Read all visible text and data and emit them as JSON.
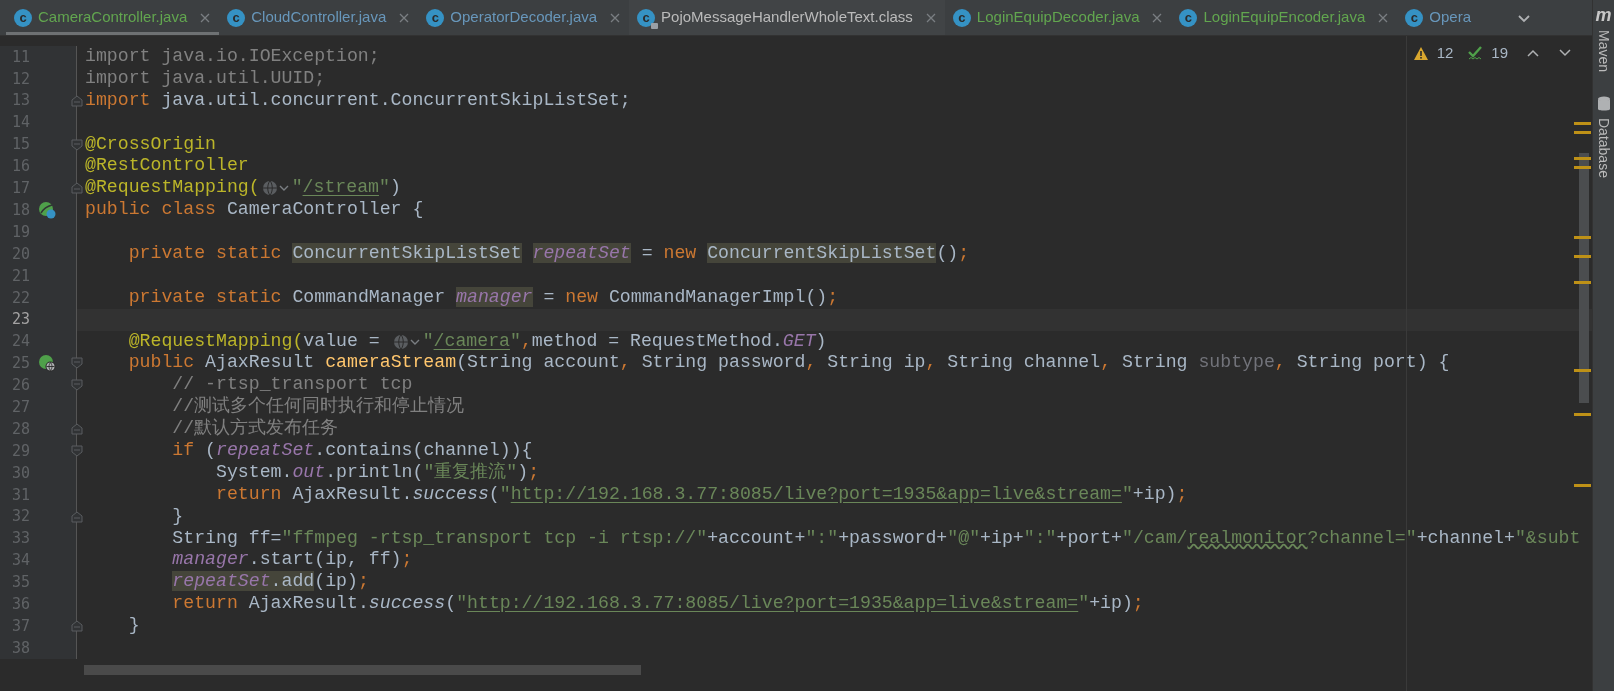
{
  "tabs": [
    {
      "label": "CameraController.java",
      "kind": "java",
      "icon_text": "c",
      "color": "#62a64f",
      "selected": true,
      "closable": true
    },
    {
      "label": "CloudController.java",
      "kind": "java",
      "icon_text": "c",
      "color": "#6897bb",
      "selected": false,
      "closable": true
    },
    {
      "label": "OperatorDecoder.java",
      "kind": "java",
      "icon_text": "c",
      "color": "#6897bb",
      "selected": false,
      "closable": true
    },
    {
      "label": "PojoMessageHandlerWholeText.class",
      "kind": "class",
      "icon_text": "c",
      "color": "#bbbbbb",
      "selected": false,
      "closable": true
    },
    {
      "label": "LoginEquipDecoder.java",
      "kind": "java",
      "icon_text": "c",
      "color": "#62a64f",
      "selected": false,
      "closable": true
    },
    {
      "label": "LoginEquipEncoder.java",
      "kind": "java",
      "icon_text": "c",
      "color": "#62a64f",
      "selected": false,
      "closable": true
    },
    {
      "label": "Opera",
      "kind": "java",
      "icon_text": "c",
      "color": "#6897bb",
      "selected": false,
      "closable": false
    }
  ],
  "inspections": {
    "warnings": "12",
    "weak_warnings": "19"
  },
  "side_tools": [
    {
      "kind": "maven",
      "icon_text": "m",
      "label": "Maven"
    },
    {
      "kind": "database",
      "label": "Database"
    }
  ],
  "lines": [
    {
      "number": "11",
      "current": false,
      "tokens": [
        {
          "kind": "unused",
          "text": "import java.io.IOException;"
        }
      ]
    },
    {
      "number": "12",
      "current": false,
      "tokens": [
        {
          "kind": "unused",
          "text": "import java.util.UUID;"
        }
      ]
    },
    {
      "number": "13",
      "current": false,
      "fold": {
        "kind": "end"
      },
      "tokens": [
        {
          "kind": "kw",
          "text": "import "
        },
        {
          "kind": "plain",
          "text": "java.util.concurrent.ConcurrentSkipListSet;"
        }
      ]
    },
    {
      "number": "14",
      "current": false
    },
    {
      "number": "15",
      "current": false,
      "fold": {
        "kind": "start"
      },
      "tokens": [
        {
          "kind": "ann",
          "text": "@CrossOrigin"
        }
      ]
    },
    {
      "number": "16",
      "current": false,
      "tokens": [
        {
          "kind": "ann",
          "text": "@RestController"
        }
      ]
    },
    {
      "number": "17",
      "current": false,
      "fold": {
        "kind": "end"
      },
      "tokens": [
        {
          "kind": "ann",
          "text": "@RequestMapping("
        },
        {
          "kind": "globe"
        },
        {
          "kind": "str",
          "text": "\""
        },
        {
          "kind": "link",
          "text": "/stream"
        },
        {
          "kind": "str",
          "text": "\""
        },
        {
          "kind": "plain",
          "text": ")"
        }
      ]
    },
    {
      "number": "18",
      "current": false,
      "gutter_icon": {
        "kind": "bean"
      },
      "tokens": [
        {
          "kind": "kw",
          "text": "public class "
        },
        {
          "kind": "plain",
          "text": "CameraController {"
        }
      ]
    },
    {
      "number": "19",
      "current": false
    },
    {
      "number": "20",
      "current": false,
      "tokens": [
        {
          "kind": "kw",
          "text": "    private static "
        },
        {
          "kind": "type_hl",
          "text": "ConcurrentSkipListSet "
        },
        {
          "kind": "field_hl",
          "text": "repeatSet"
        },
        {
          "kind": "plain",
          "text": " = "
        },
        {
          "kind": "kw",
          "text": "new "
        },
        {
          "kind": "type_hl",
          "text": "ConcurrentSkipListSet"
        },
        {
          "kind": "plain",
          "text": "()"
        },
        {
          "kind": "kw",
          "text": ";"
        }
      ]
    },
    {
      "number": "21",
      "current": false
    },
    {
      "number": "22",
      "current": false,
      "tokens": [
        {
          "kind": "kw",
          "text": "    private static "
        },
        {
          "kind": "plain",
          "text": "CommandManager "
        },
        {
          "kind": "field_hl",
          "text": "manager"
        },
        {
          "kind": "plain",
          "text": " = "
        },
        {
          "kind": "kw",
          "text": "new "
        },
        {
          "kind": "plain",
          "text": "CommandManagerImpl()"
        },
        {
          "kind": "kw",
          "text": ";"
        }
      ]
    },
    {
      "number": "23",
      "current": true
    },
    {
      "number": "24",
      "current": false,
      "tokens": [
        {
          "kind": "ann",
          "text": "    @RequestMapping("
        },
        {
          "kind": "plain",
          "text": "value = "
        },
        {
          "kind": "globe"
        },
        {
          "kind": "str",
          "text": "\""
        },
        {
          "kind": "link",
          "text": "/camera"
        },
        {
          "kind": "str",
          "text": "\""
        },
        {
          "kind": "kw",
          "text": ","
        },
        {
          "kind": "plain",
          "text": "method = RequestMethod."
        },
        {
          "kind": "field",
          "text": "GET"
        },
        {
          "kind": "plain",
          "text": ")"
        }
      ]
    },
    {
      "number": "25",
      "current": false,
      "gutter_icon": {
        "kind": "web"
      },
      "fold": {
        "kind": "start"
      },
      "tokens": [
        {
          "kind": "kw",
          "text": "    public "
        },
        {
          "kind": "plain",
          "text": "AjaxResult "
        },
        {
          "kind": "method",
          "text": "cameraStream"
        },
        {
          "kind": "plain",
          "text": "(String account"
        },
        {
          "kind": "kw",
          "text": ", "
        },
        {
          "kind": "plain",
          "text": "String password"
        },
        {
          "kind": "kw",
          "text": ", "
        },
        {
          "kind": "plain",
          "text": "String ip"
        },
        {
          "kind": "kw",
          "text": ", "
        },
        {
          "kind": "plain",
          "text": "String channel"
        },
        {
          "kind": "kw",
          "text": ", "
        },
        {
          "kind": "plain",
          "text": "String "
        },
        {
          "kind": "param_unused",
          "text": "subtype"
        },
        {
          "kind": "kw",
          "text": ", "
        },
        {
          "kind": "plain",
          "text": "String port) {"
        }
      ]
    },
    {
      "number": "26",
      "current": false,
      "fold": {
        "kind": "start"
      },
      "tokens": [
        {
          "kind": "comment",
          "text": "        // -rtsp_transport tcp"
        }
      ]
    },
    {
      "number": "27",
      "current": false,
      "tokens": [
        {
          "kind": "comment",
          "text": "        //测试多个任何同时执行和停止情况"
        }
      ]
    },
    {
      "number": "28",
      "current": false,
      "fold": {
        "kind": "end"
      },
      "tokens": [
        {
          "kind": "comment",
          "text": "        //默认方式发布任务"
        }
      ]
    },
    {
      "number": "29",
      "current": false,
      "fold": {
        "kind": "start"
      },
      "tokens": [
        {
          "kind": "kw",
          "text": "        if "
        },
        {
          "kind": "plain",
          "text": "("
        },
        {
          "kind": "field",
          "text": "repeatSet"
        },
        {
          "kind": "plain",
          "text": ".contains(channel)){"
        }
      ]
    },
    {
      "number": "30",
      "current": false,
      "tokens": [
        {
          "kind": "plain",
          "text": "            System."
        },
        {
          "kind": "field",
          "text": "out"
        },
        {
          "kind": "plain",
          "text": ".println("
        },
        {
          "kind": "str",
          "text": "\"重复推流\""
        },
        {
          "kind": "plain",
          "text": ")"
        },
        {
          "kind": "kw",
          "text": ";"
        }
      ]
    },
    {
      "number": "31",
      "current": false,
      "tokens": [
        {
          "kind": "kw",
          "text": "            return "
        },
        {
          "kind": "plain",
          "text": "AjaxResult."
        },
        {
          "kind": "static",
          "text": "success"
        },
        {
          "kind": "plain",
          "text": "("
        },
        {
          "kind": "str",
          "text": "\""
        },
        {
          "kind": "link",
          "text": "http://192.168.3.77:8085/live?port=1935&app=live&stream="
        },
        {
          "kind": "str",
          "text": "\""
        },
        {
          "kind": "plain",
          "text": "+ip)"
        },
        {
          "kind": "kw",
          "text": ";"
        }
      ]
    },
    {
      "number": "32",
      "current": false,
      "fold": {
        "kind": "end"
      },
      "tokens": [
        {
          "kind": "plain",
          "text": "        }"
        }
      ]
    },
    {
      "number": "33",
      "current": false,
      "tokens": [
        {
          "kind": "plain",
          "text": "        String ff="
        },
        {
          "kind": "str",
          "text": "\"ffmpeg -rtsp_transport tcp -i rtsp://\""
        },
        {
          "kind": "plain",
          "text": "+account+"
        },
        {
          "kind": "str",
          "text": "\":\""
        },
        {
          "kind": "plain",
          "text": "+password+"
        },
        {
          "kind": "str",
          "text": "\"@\""
        },
        {
          "kind": "plain",
          "text": "+ip+"
        },
        {
          "kind": "str",
          "text": "\":\""
        },
        {
          "kind": "plain",
          "text": "+port+"
        },
        {
          "kind": "str",
          "text": "\"/cam/"
        },
        {
          "kind": "typo",
          "text": "realmonitor"
        },
        {
          "kind": "str",
          "text": "?channel=\""
        },
        {
          "kind": "plain",
          "text": "+channel+"
        },
        {
          "kind": "str",
          "text": "\"&subt"
        }
      ]
    },
    {
      "number": "34",
      "current": false,
      "tokens": [
        {
          "kind": "field",
          "text": "        manager"
        },
        {
          "kind": "plain",
          "text": ".start(ip, ff)"
        },
        {
          "kind": "kw",
          "text": ";"
        }
      ]
    },
    {
      "number": "35",
      "current": false,
      "tokens": [
        {
          "kind": "field_hl",
          "text": "        repeatSet"
        },
        {
          "kind": "plain_hl",
          "text": ".add"
        },
        {
          "kind": "plain",
          "text": "(ip)"
        },
        {
          "kind": "kw",
          "text": ";"
        }
      ]
    },
    {
      "number": "36",
      "current": false,
      "tokens": [
        {
          "kind": "kw",
          "text": "        return "
        },
        {
          "kind": "plain",
          "text": "AjaxResult."
        },
        {
          "kind": "static",
          "text": "success"
        },
        {
          "kind": "plain",
          "text": "("
        },
        {
          "kind": "str",
          "text": "\""
        },
        {
          "kind": "link",
          "text": "http://192.168.3.77:8085/live?port=1935&app=live&stream="
        },
        {
          "kind": "str",
          "text": "\""
        },
        {
          "kind": "plain",
          "text": "+ip)"
        },
        {
          "kind": "kw",
          "text": ";"
        }
      ]
    },
    {
      "number": "37",
      "current": false,
      "fold": {
        "kind": "end"
      },
      "tokens": [
        {
          "kind": "plain",
          "text": "    }"
        }
      ]
    },
    {
      "number": "38",
      "current": false
    }
  ]
}
